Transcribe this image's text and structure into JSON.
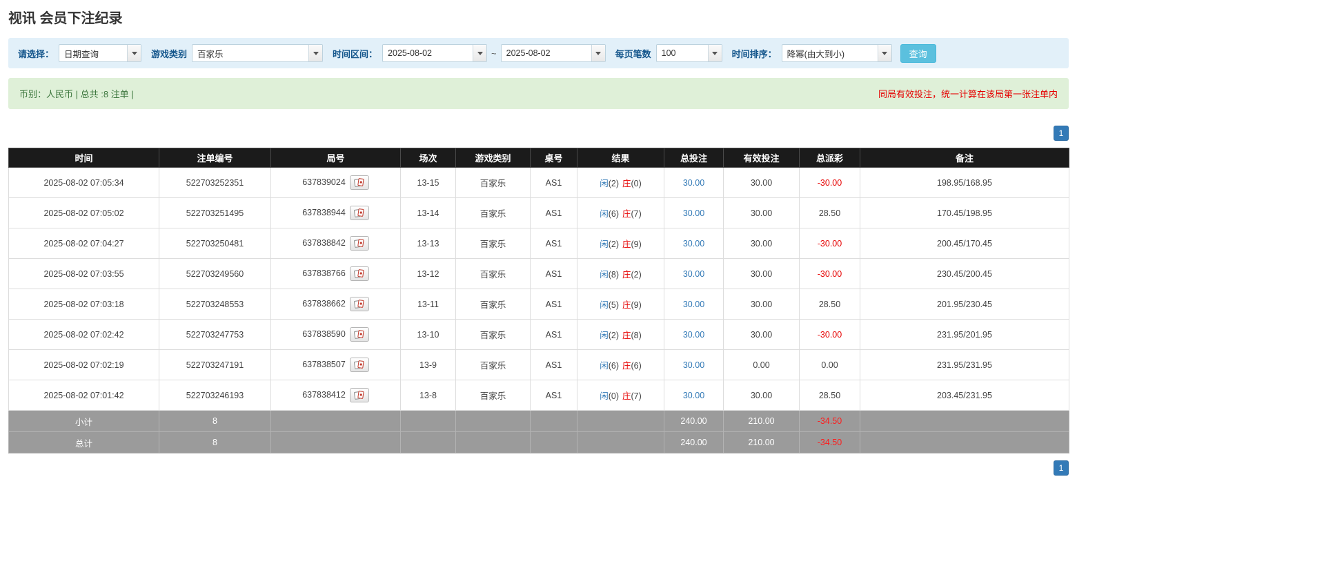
{
  "page": {
    "title": "视讯 会员下注纪录"
  },
  "colors": {
    "filter_bg": "#e2f0f9",
    "accent_button": "#5bc0de",
    "link_blue": "#337ab7",
    "red": "#e60000",
    "green_bar_bg": "#dff0d8",
    "green_text": "#3c763d",
    "header_bg": "#1b1b1b",
    "summary_bg": "#9b9b9b"
  },
  "icons": {
    "dropdown_arrow": "triangle-down",
    "round_cards_button": "playing-cards"
  },
  "filters": {
    "select_label": "请选择：",
    "select_value": "日期查询",
    "game_type_label": "游戏类别",
    "game_type_value": "百家乐",
    "time_range_label": "时间区间：",
    "time_from": "2025-08-02",
    "tilde": "~",
    "time_to": "2025-08-02",
    "page_size_label": "每页笔数",
    "page_size_value": "100",
    "sort_label": "时间排序：",
    "sort_value": "降幂(由大到小)",
    "search_button": "查询"
  },
  "info_bar": {
    "left": "币别：人民币 | 总共 :8 注单 |",
    "right": "同局有效投注，统一计算在该局第一张注单内"
  },
  "pagination": {
    "page": "1"
  },
  "table": {
    "headers": [
      "时间",
      "注单编号",
      "局号",
      "场次",
      "游戏类别",
      "桌号",
      "结果",
      "总投注",
      "有效投注",
      "总派彩",
      "备注"
    ],
    "rows": [
      {
        "time": "2025-08-02 07:05:34",
        "bet_id": "522703252351",
        "round_id": "637839024",
        "session": "13-15",
        "game": "百家乐",
        "table_no": "AS1",
        "player": "闲",
        "player_n": "(2)",
        "banker": "庄",
        "banker_n": "(0)",
        "total_bet": "30.00",
        "valid_bet": "30.00",
        "payout": "-30.00",
        "note": "198.95/168.95"
      },
      {
        "time": "2025-08-02 07:05:02",
        "bet_id": "522703251495",
        "round_id": "637838944",
        "session": "13-14",
        "game": "百家乐",
        "table_no": "AS1",
        "player": "闲",
        "player_n": "(6)",
        "banker": "庄",
        "banker_n": "(7)",
        "total_bet": "30.00",
        "valid_bet": "30.00",
        "payout": "28.50",
        "note": "170.45/198.95"
      },
      {
        "time": "2025-08-02 07:04:27",
        "bet_id": "522703250481",
        "round_id": "637838842",
        "session": "13-13",
        "game": "百家乐",
        "table_no": "AS1",
        "player": "闲",
        "player_n": "(2)",
        "banker": "庄",
        "banker_n": "(9)",
        "total_bet": "30.00",
        "valid_bet": "30.00",
        "payout": "-30.00",
        "note": "200.45/170.45"
      },
      {
        "time": "2025-08-02 07:03:55",
        "bet_id": "522703249560",
        "round_id": "637838766",
        "session": "13-12",
        "game": "百家乐",
        "table_no": "AS1",
        "player": "闲",
        "player_n": "(8)",
        "banker": "庄",
        "banker_n": "(2)",
        "total_bet": "30.00",
        "valid_bet": "30.00",
        "payout": "-30.00",
        "note": "230.45/200.45"
      },
      {
        "time": "2025-08-02 07:03:18",
        "bet_id": "522703248553",
        "round_id": "637838662",
        "session": "13-11",
        "game": "百家乐",
        "table_no": "AS1",
        "player": "闲",
        "player_n": "(5)",
        "banker": "庄",
        "banker_n": "(9)",
        "total_bet": "30.00",
        "valid_bet": "30.00",
        "payout": "28.50",
        "note": "201.95/230.45"
      },
      {
        "time": "2025-08-02 07:02:42",
        "bet_id": "522703247753",
        "round_id": "637838590",
        "session": "13-10",
        "game": "百家乐",
        "table_no": "AS1",
        "player": "闲",
        "player_n": "(2)",
        "banker": "庄",
        "banker_n": "(8)",
        "total_bet": "30.00",
        "valid_bet": "30.00",
        "payout": "-30.00",
        "note": "231.95/201.95"
      },
      {
        "time": "2025-08-02 07:02:19",
        "bet_id": "522703247191",
        "round_id": "637838507",
        "session": "13-9",
        "game": "百家乐",
        "table_no": "AS1",
        "player": "闲",
        "player_n": "(6)",
        "banker": "庄",
        "banker_n": "(6)",
        "total_bet": "30.00",
        "valid_bet": "0.00",
        "payout": "0.00",
        "note": "231.95/231.95"
      },
      {
        "time": "2025-08-02 07:01:42",
        "bet_id": "522703246193",
        "round_id": "637838412",
        "session": "13-8",
        "game": "百家乐",
        "table_no": "AS1",
        "player": "闲",
        "player_n": "(0)",
        "banker": "庄",
        "banker_n": "(7)",
        "total_bet": "30.00",
        "valid_bet": "30.00",
        "payout": "28.50",
        "note": "203.45/231.95"
      }
    ],
    "subtotal": {
      "label": "小计",
      "count": "8",
      "total_bet": "240.00",
      "valid_bet": "210.00",
      "payout": "-34.50"
    },
    "grand_total": {
      "label": "总计",
      "count": "8",
      "total_bet": "240.00",
      "valid_bet": "210.00",
      "payout": "-34.50"
    }
  }
}
